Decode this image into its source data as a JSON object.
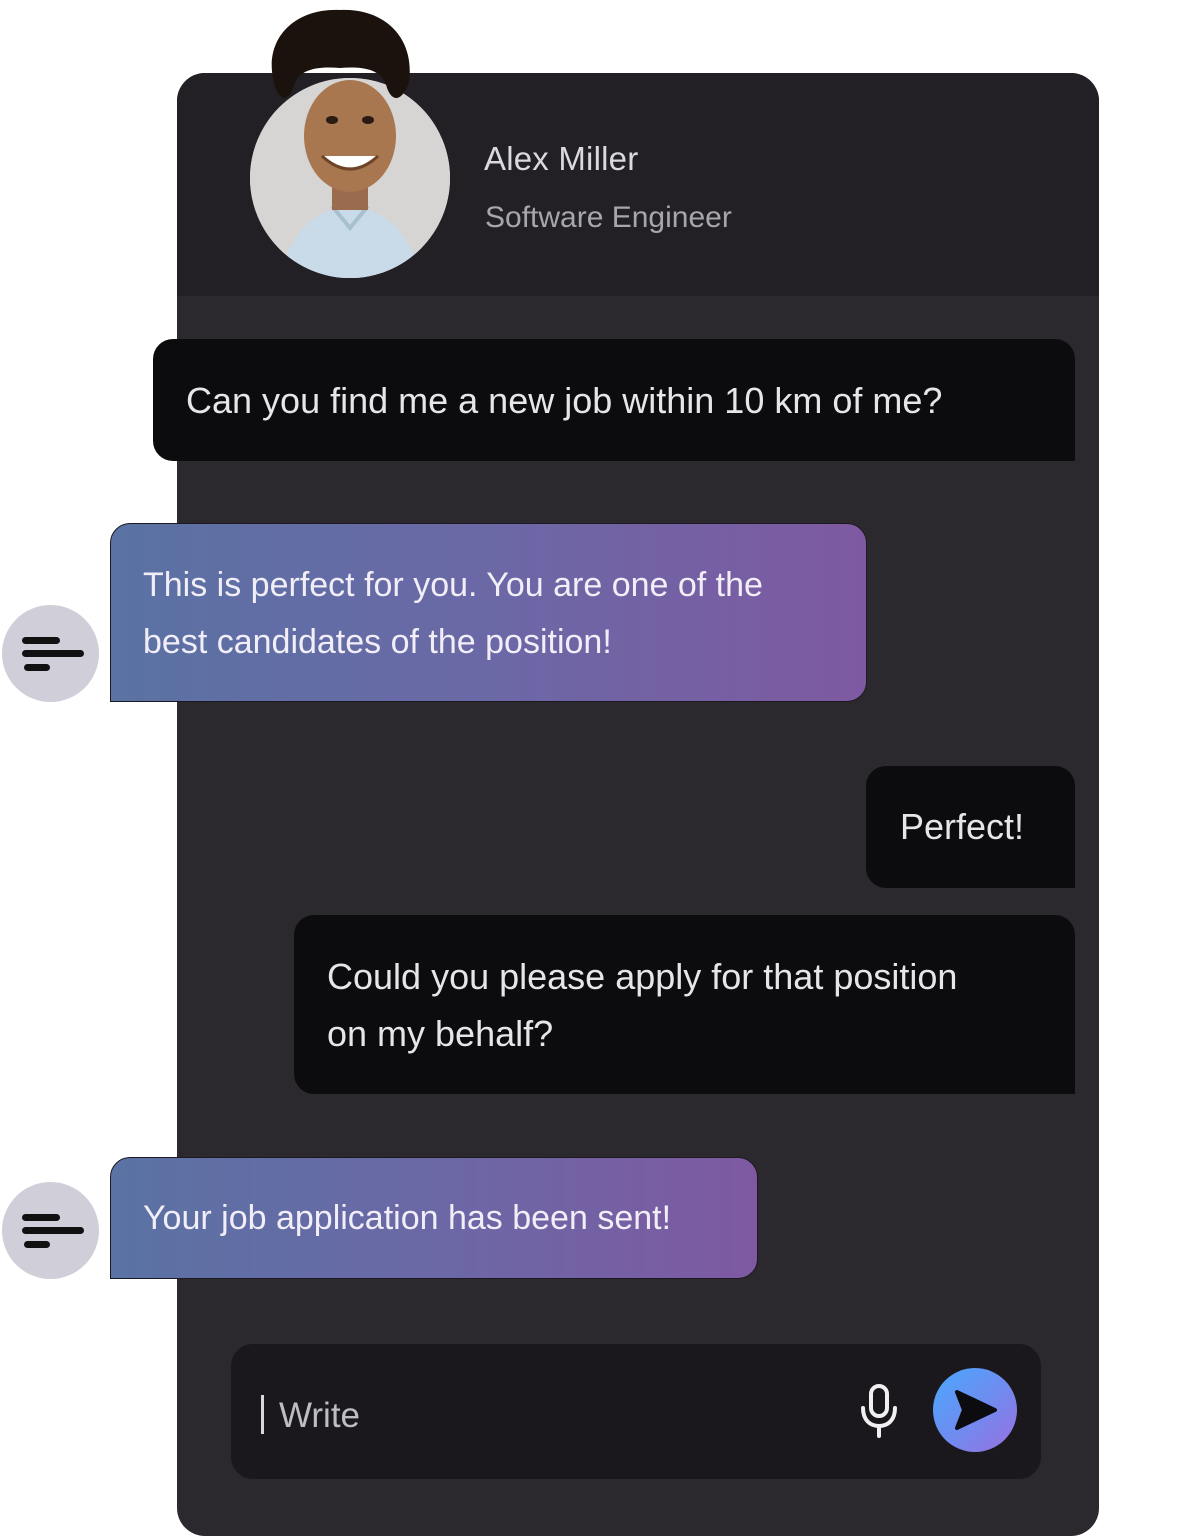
{
  "profile": {
    "name": "Alex Miller",
    "title": "Software Engineer",
    "avatar_icon": "avatar-photo"
  },
  "messages": [
    {
      "sender": "user",
      "lines": [
        "Can you find me a new  job within 10 km of me?"
      ]
    },
    {
      "sender": "assistant",
      "lines": [
        "This is perfect for you. You are one of  the",
        "best candidates of the position!"
      ]
    },
    {
      "sender": "user",
      "lines": [
        "Perfect!"
      ]
    },
    {
      "sender": "user",
      "lines": [
        "Could you please apply for that position",
        "on my behalf?"
      ]
    },
    {
      "sender": "assistant",
      "lines": [
        "Your job application has been sent!"
      ]
    }
  ],
  "composer": {
    "placeholder": "Write",
    "mic_icon": "microphone-icon",
    "send_icon": "send-icon"
  },
  "colors": {
    "panel": "#2b282e",
    "header": "#222024",
    "user_bubble": "#0c0b0e",
    "bot_gradient_start": "#5a72a4",
    "bot_gradient_end": "#7e59a2",
    "send_start": "#4aa8ff",
    "send_end": "#9a6fe0"
  }
}
